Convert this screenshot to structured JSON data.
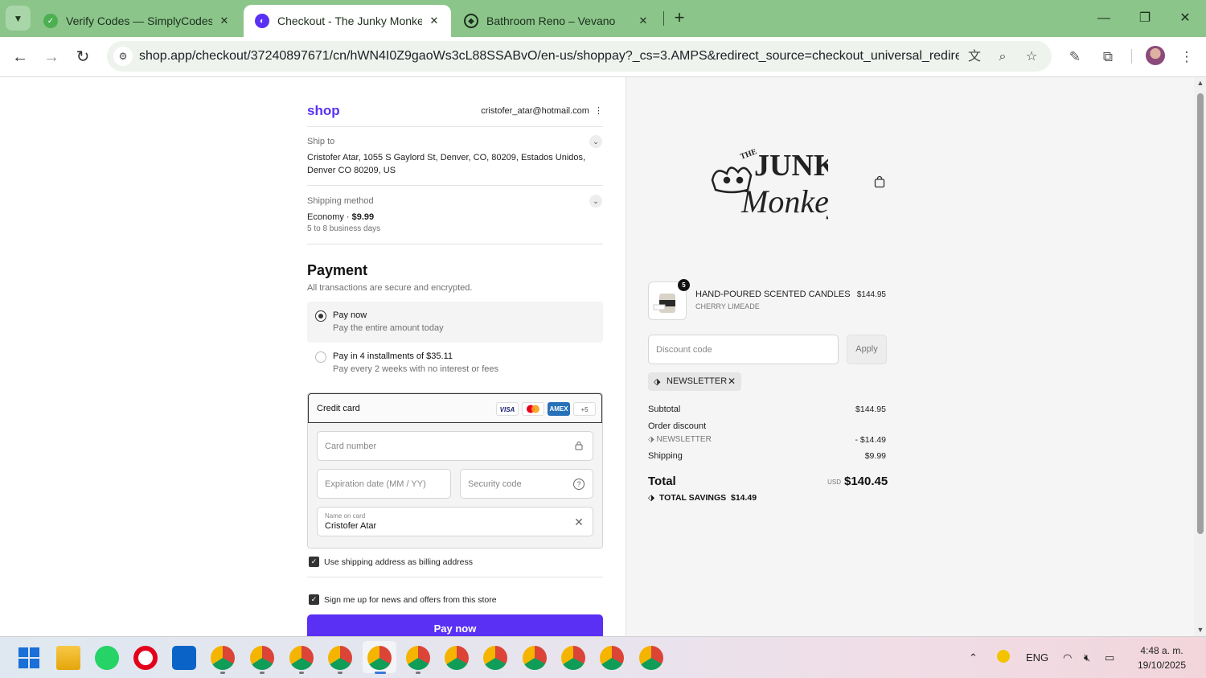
{
  "browser": {
    "tabs": [
      {
        "title": "Verify Codes — SimplyCodes",
        "icon": "simplycodes-icon"
      },
      {
        "title": "Checkout - The Junky Monkey",
        "icon": "shop-icon"
      },
      {
        "title": "Bathroom Reno – Vevano",
        "icon": "vevano-icon"
      }
    ],
    "url": "shop.app/checkout/37240897671/cn/hWN4I0Z9gaoWs3cL88SSABvO/en-us/shoppay?_cs=3.AMPS&redirect_source=checkout_universal_redirect&tr..."
  },
  "checkout": {
    "logo": "shop",
    "account": "cristofer_atar@hotmail.com",
    "ship_to_label": "Ship to",
    "ship_to_value": "Cristofer Atar, 1055 S Gaylord St, Denver, CO, 80209, Estados Unidos, Denver CO 80209, US",
    "shipping_method_label": "Shipping method",
    "shipping_method_name": "Economy · ",
    "shipping_method_price": "$9.99",
    "shipping_method_eta": "5 to 8 business days",
    "payment_title": "Payment",
    "payment_subtitle": "All transactions are secure and encrypted.",
    "options": [
      {
        "title": "Pay now",
        "desc": "Pay the entire amount today",
        "selected": true
      },
      {
        "title": "Pay in 4 installments of $35.11",
        "desc": "Pay every 2 weeks with no interest or fees",
        "selected": false
      }
    ],
    "credit_card_label": "Credit card",
    "card_brands": [
      "VISA",
      "",
      "AMEX",
      "+5"
    ],
    "card_number_placeholder": "Card number",
    "expiration_placeholder": "Expiration date (MM / YY)",
    "security_placeholder": "Security code",
    "name_label": "Name on card",
    "name_value": "Cristofer Atar",
    "billing_checkbox": "Use shipping address as billing address",
    "news_checkbox": "Sign me up for news and offers from this store",
    "pay_button": "Pay now",
    "accent_color": "#5a31f4"
  },
  "summary": {
    "item_qty": "5",
    "item_name": "HAND-POURED SCENTED CANDLES",
    "item_variant": "CHERRY LIMEADE",
    "item_price": "$144.95",
    "discount_placeholder": "Discount code",
    "apply_label": "Apply",
    "applied_code": "NEWSLETTER",
    "subtotal_label": "Subtotal",
    "subtotal_value": "$144.95",
    "order_discount_label": "Order discount",
    "discount_code_label": "NEWSLETTER",
    "discount_value": "- $14.49",
    "shipping_label": "Shipping",
    "shipping_value": "$9.99",
    "total_label": "Total",
    "total_currency": "USD",
    "total_value": "$140.45",
    "savings_label": "TOTAL SAVINGS",
    "savings_value": "$14.49"
  },
  "taskbar": {
    "language": "ENG",
    "time": "4:48 a. m.",
    "date": "19/10/2025"
  }
}
